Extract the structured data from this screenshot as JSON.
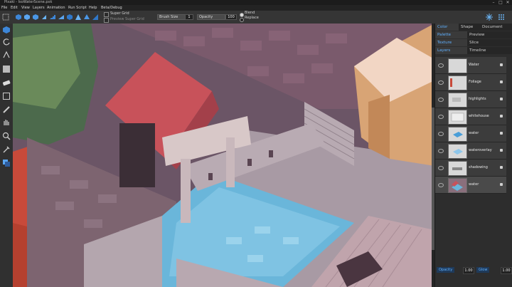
{
  "window": {
    "title": "Pixaki - IsoWaterScene.pxk",
    "min": "–",
    "max": "□",
    "close": "✕"
  },
  "menu": [
    "File",
    "Edit",
    "View",
    "Layers",
    "Animation",
    "Run Script",
    "Help",
    "Beta/Debug"
  ],
  "toolbar": {
    "super_grid": "Super Grid",
    "preview_super_grid": "Preview Super Grid",
    "brush_size_label": "Brush Size",
    "brush_size_value": "1",
    "opacity_label": "Opacity",
    "opacity_value": "100",
    "blend_label": "Blend",
    "replace_label": "Replace"
  },
  "panel": {
    "tabs_row1": [
      "Color",
      "Shape",
      "Document"
    ],
    "tabs_row2": [
      "Palette",
      "Preview"
    ],
    "tabs_row3": [
      "Texture",
      "Slice"
    ],
    "tabs_row4": [
      "Layers",
      "Timeline"
    ],
    "layers": [
      {
        "name": "Water"
      },
      {
        "name": "Foliage"
      },
      {
        "name": "highlights"
      },
      {
        "name": "whitehouse"
      },
      {
        "name": "water"
      },
      {
        "name": "wateroverlay"
      },
      {
        "name": "shadowing"
      },
      {
        "name": "water"
      }
    ],
    "bottom": {
      "opacity_label": "Opacity",
      "opacity_value": "1.00",
      "glow_label": "Glow",
      "glow_value": "1.00"
    }
  },
  "colors": {
    "accent": "#5fb0ff",
    "water": "#6ab6da",
    "roof": "#c8525a"
  }
}
